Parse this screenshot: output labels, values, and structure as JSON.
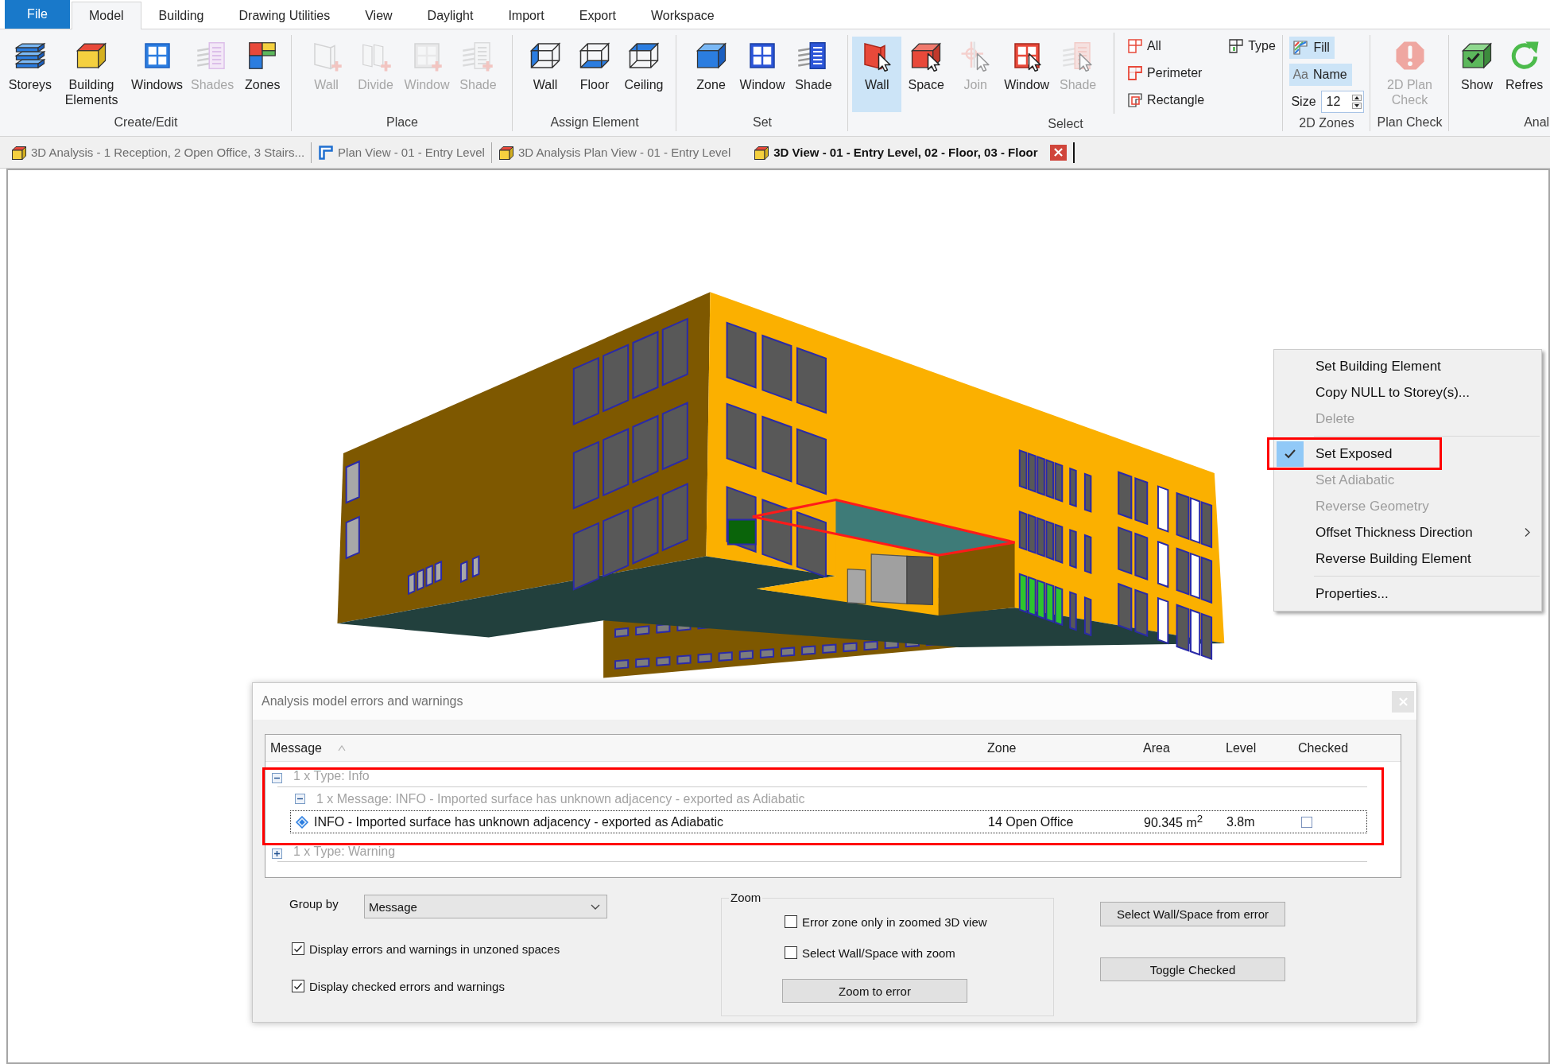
{
  "ribbon": {
    "tabs": [
      {
        "label": "File",
        "kind": "file",
        "selected": false
      },
      {
        "label": "Model",
        "kind": "tab",
        "selected": true
      },
      {
        "label": "Building",
        "kind": "tab",
        "selected": false
      },
      {
        "label": "Drawing Utilities",
        "kind": "tab",
        "selected": false
      },
      {
        "label": "View",
        "kind": "tab",
        "selected": false
      },
      {
        "label": "Daylight",
        "kind": "tab",
        "selected": false
      },
      {
        "label": "Import",
        "kind": "tab",
        "selected": false
      },
      {
        "label": "Export",
        "kind": "tab",
        "selected": false
      },
      {
        "label": "Workspace",
        "kind": "tab",
        "selected": false
      }
    ],
    "groups": [
      {
        "label": "Create/Edit",
        "buttons": [
          {
            "label": "Storeys",
            "disabled": false
          },
          {
            "label": "Building Elements",
            "disabled": false
          },
          {
            "label": "Windows",
            "disabled": false
          },
          {
            "label": "Shades",
            "disabled": true
          },
          {
            "label": "Zones",
            "disabled": false
          }
        ]
      },
      {
        "label": "Place",
        "buttons": [
          {
            "label": "Wall",
            "disabled": true
          },
          {
            "label": "Divide",
            "disabled": true
          },
          {
            "label": "Window",
            "disabled": true
          },
          {
            "label": "Shade",
            "disabled": true
          }
        ]
      },
      {
        "label": "Assign Element",
        "buttons": [
          {
            "label": "Wall",
            "disabled": false
          },
          {
            "label": "Floor",
            "disabled": false
          },
          {
            "label": "Ceiling",
            "disabled": false
          }
        ]
      },
      {
        "label": "Set",
        "buttons": [
          {
            "label": "Zone",
            "disabled": false
          },
          {
            "label": "Window",
            "disabled": false
          },
          {
            "label": "Shade",
            "disabled": false
          }
        ]
      },
      {
        "label": "Select",
        "buttons": [
          {
            "label": "Wall",
            "disabled": false,
            "selected": true
          },
          {
            "label": "Space",
            "disabled": false,
            "selected": false
          },
          {
            "label": "Join",
            "disabled": true,
            "selected": false
          },
          {
            "label": "Window",
            "disabled": false,
            "selected": false
          },
          {
            "label": "Shade",
            "disabled": true,
            "selected": false
          }
        ],
        "small_buttons": [
          {
            "label": "All"
          },
          {
            "label": "Perimeter"
          },
          {
            "label": "Rectangle"
          },
          {
            "label": "Type"
          }
        ]
      },
      {
        "label": "2D Zones",
        "toggles": [
          {
            "label": "Fill",
            "selected": true
          },
          {
            "label": "Name",
            "icon_text": "Aa",
            "selected": true
          }
        ],
        "size": {
          "label": "Size",
          "value": "12"
        }
      },
      {
        "label": "Plan Check",
        "buttons": [
          {
            "label": "2D Plan Check",
            "disabled": true
          }
        ]
      },
      {
        "label": "Anal",
        "buttons": [
          {
            "label": "Show",
            "disabled": false
          },
          {
            "label": "Refres",
            "disabled": false
          }
        ]
      }
    ]
  },
  "document_tabs": [
    {
      "title": "3D Analysis - 1 Reception, 2 Open Office, 3 Stairs...",
      "kind": "model",
      "selected": false
    },
    {
      "title": "Plan View - 01 - Entry Level",
      "kind": "plan",
      "selected": false
    },
    {
      "title": "3D Analysis Plan View - 01 - Entry Level",
      "kind": "model",
      "selected": false
    },
    {
      "title": "3D View - 01 - Entry Level, 02 - Floor, 03 - Floor",
      "kind": "model",
      "selected": true
    }
  ],
  "context_menu": {
    "sections": [
      [
        {
          "label": "Set Building Element",
          "disabled": false,
          "checked": false,
          "submenu": false,
          "annotated": false
        },
        {
          "label": "Copy NULL to Storey(s)...",
          "disabled": false,
          "checked": false,
          "submenu": false,
          "annotated": false
        },
        {
          "label": "Delete",
          "disabled": true,
          "checked": false,
          "submenu": false,
          "annotated": false
        }
      ],
      [
        {
          "label": "Set Exposed",
          "disabled": false,
          "checked": true,
          "submenu": false,
          "annotated": true
        },
        {
          "label": "Set Adiabatic",
          "disabled": true,
          "checked": false,
          "submenu": false,
          "annotated": false
        },
        {
          "label": "Reverse Geometry",
          "disabled": true,
          "checked": false,
          "submenu": false,
          "annotated": false
        },
        {
          "label": "Offset Thickness Direction",
          "disabled": false,
          "checked": false,
          "submenu": true,
          "annotated": false
        },
        {
          "label": "Reverse Building Element",
          "disabled": false,
          "checked": false,
          "submenu": false,
          "annotated": false
        }
      ],
      [
        {
          "label": "Properties...",
          "disabled": false,
          "checked": false,
          "submenu": false,
          "annotated": false
        }
      ]
    ]
  },
  "dialog": {
    "title": "Analysis model errors and warnings",
    "grid": {
      "columns": [
        {
          "label": "Message",
          "sorted": true
        },
        {
          "label": "Zone",
          "sorted": false
        },
        {
          "label": "Area",
          "sorted": false
        },
        {
          "label": "Level",
          "sorted": false
        },
        {
          "label": "Checked",
          "sorted": false
        }
      ],
      "groups": [
        {
          "label": "1 x Type: Info",
          "expanded": true,
          "annotated": true,
          "children": [
            {
              "label": "1 x Message: INFO - Imported surface has unknown adjacency - exported as Adiabatic",
              "expanded": true,
              "rows": [
                {
                  "kind": "info",
                  "message": "INFO - Imported surface has unknown adjacency - exported as Adiabatic",
                  "zone": "14 Open Office",
                  "area": "90.345 m$^{2}$",
                  "level": "3.8m",
                  "checked": false,
                  "focused": true
                }
              ]
            }
          ]
        },
        {
          "label": "1 x Type: Warning",
          "expanded": false,
          "annotated": false
        }
      ]
    },
    "group_by": {
      "label": "Group by",
      "value": "Message"
    },
    "options": [
      {
        "label": "Display errors and warnings in unzoned spaces",
        "checked": true
      },
      {
        "label": "Display checked errors and warnings",
        "checked": true
      }
    ],
    "zoom": {
      "label": "Zoom",
      "options": [
        {
          "label": "Error zone only in zoomed 3D view",
          "checked": false
        },
        {
          "label": "Select Wall/Space with zoom",
          "checked": false
        }
      ],
      "button": "Zoom to error"
    },
    "buttons": [
      "Select Wall/Space from error",
      "Toggle Checked"
    ]
  }
}
